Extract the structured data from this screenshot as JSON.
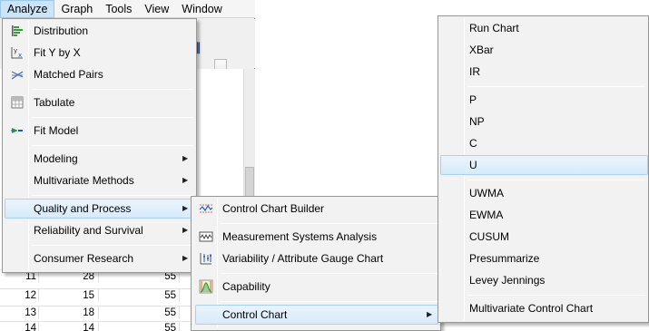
{
  "menubar": {
    "items": [
      {
        "label": "Analyze"
      },
      {
        "label": "Graph"
      },
      {
        "label": "Tools"
      },
      {
        "label": "View"
      },
      {
        "label": "Window"
      }
    ]
  },
  "table": {
    "rows": [
      {
        "row": "11",
        "a": "28",
        "b": "55"
      },
      {
        "row": "12",
        "a": "15",
        "b": "55"
      },
      {
        "row": "13",
        "a": "18",
        "b": "55"
      },
      {
        "row": "14",
        "a": "14",
        "b": "55"
      }
    ]
  },
  "analyze_menu": {
    "items": [
      {
        "label": "Distribution",
        "icon": "distribution-icon"
      },
      {
        "label": "Fit Y by X",
        "icon": "fit-y-by-x-icon"
      },
      {
        "label": "Matched Pairs",
        "icon": "matched-pairs-icon"
      },
      {
        "label": "Tabulate",
        "icon": "tabulate-icon"
      },
      {
        "label": "Fit Model",
        "icon": "fit-model-icon"
      },
      {
        "label": "Modeling"
      },
      {
        "label": "Multivariate Methods"
      },
      {
        "label": "Quality and Process"
      },
      {
        "label": "Reliability and Survival"
      },
      {
        "label": "Consumer Research"
      }
    ]
  },
  "quality_menu": {
    "items": [
      {
        "label": "Control Chart Builder",
        "icon": "control-chart-builder-icon"
      },
      {
        "label": "Measurement Systems Analysis",
        "icon": "measurement-systems-icon"
      },
      {
        "label": "Variability / Attribute Gauge Chart",
        "icon": "variability-gauge-icon"
      },
      {
        "label": "Capability",
        "icon": "capability-icon"
      },
      {
        "label": "Control Chart"
      }
    ]
  },
  "control_chart_menu": {
    "items": [
      {
        "label": "Run Chart"
      },
      {
        "label": "XBar"
      },
      {
        "label": "IR"
      },
      {
        "label": "P"
      },
      {
        "label": "NP"
      },
      {
        "label": "C"
      },
      {
        "label": "U"
      },
      {
        "label": "UWMA"
      },
      {
        "label": "EWMA"
      },
      {
        "label": "CUSUM"
      },
      {
        "label": "Presummarize"
      },
      {
        "label": "Levey Jennings"
      },
      {
        "label": "Multivariate Control Chart"
      }
    ]
  },
  "colors": {
    "highlight": "#d8eafa",
    "highlight_border": "#a9d0f3",
    "menu_bg": "#f2f2f2"
  }
}
